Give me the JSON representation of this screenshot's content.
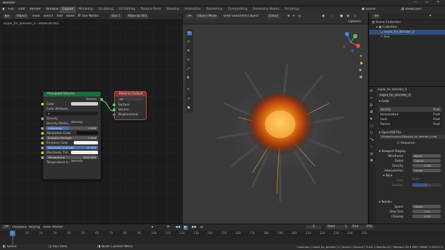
{
  "app": {
    "title": "Blender"
  },
  "menu": [
    "File",
    "Edit",
    "Render",
    "Window",
    "Help"
  ],
  "tabs": [
    "Layout",
    "Modeling",
    "Sculpting",
    "UV Editing",
    "Texture Paint",
    "Shading",
    "Animation",
    "Rendering",
    "Compositing",
    "Geometry Nodes",
    "Scripting"
  ],
  "scene": {
    "label": "Scene",
    "layer": "ViewLayer"
  },
  "node_editor": {
    "header": {
      "type": "Object",
      "view": "View",
      "select": "Select",
      "add": "Add",
      "node": "Node",
      "use_nodes": "Use Nodes",
      "slot": "Slot 1",
      "material": "Material.001"
    },
    "breadcrumb": [
      "explo_for_blender_0",
      "Material.001"
    ],
    "principled": {
      "title": "Principled Volume",
      "output": "Volume",
      "rows": {
        "color": "Color",
        "color_attr": "Color Attribute",
        "color_attr_val": "d",
        "density": "Density",
        "density_attr": "Density Attribu...",
        "density_attr_val": "density",
        "anisotropy": "Anisotropy",
        "anisotropy_val": "0.000",
        "absorption": "Absorption Color",
        "emission_strength": "Emission Strength",
        "emission_strength_val": "0.000",
        "emission_color": "Emission Color",
        "blackbody": "Blackbody Intensity",
        "blackbody_val": "10.000",
        "blackbody_tint": "Blackbody Tint",
        "temperature": "Temperature",
        "temperature_val": "4000.000",
        "temperature_attr": "Temperature A...",
        "temperature_attr_val": "density"
      }
    },
    "output": {
      "title": "Material Output",
      "target": "All",
      "surface": "Surface",
      "volume": "Volume",
      "displacement": "Displacement"
    }
  },
  "viewport": {
    "mode": "Object Mode",
    "view": "View",
    "select": "Select",
    "add": "Add",
    "object": "Object",
    "orientation": "Global",
    "options": "Options"
  },
  "outliner": {
    "search": "",
    "items": [
      {
        "label": "Scene Collection"
      },
      {
        "label": "Collection"
      },
      {
        "label": "explo_for_blender_0"
      },
      {
        "label": "Sun"
      }
    ]
  },
  "properties": {
    "object": "explo_for_blender_0",
    "data": "explo_for_blender_0",
    "grids_title": "Grids",
    "grids": [
      {
        "name": "density",
        "type": "Float"
      },
      {
        "name": "temperature",
        "type": "Float"
      },
      {
        "name": "heat",
        "type": "Float"
      },
      {
        "name": "flames",
        "type": "Float"
      }
    ],
    "openvdb_title": "OpenVDB File",
    "file": "\\\\Fireball\\explo\\VDB\\explo_for_blender_0.vdb",
    "sequence": "Sequence",
    "viewport_display": "Viewport Display",
    "wireframe": {
      "label": "Wireframe",
      "value": "Boxes"
    },
    "detail": {
      "label": "Detail",
      "value": "Coarse"
    },
    "density": {
      "label": "Density",
      "value": "1.000"
    },
    "interp": {
      "label": "Interpolation",
      "value": "Linear"
    },
    "slice": "Slice",
    "axis": {
      "label": "Axis",
      "value": "Auto"
    },
    "position": {
      "label": "Position",
      "value": "0.5"
    },
    "render": "Render",
    "space": {
      "label": "Space",
      "value": "Object"
    },
    "step": {
      "label": "Step Size",
      "value": "0 m"
    },
    "clipping": {
      "label": "Clipping",
      "value": "0.001"
    }
  },
  "timeline": {
    "playback": "Playback",
    "keying": "Keying",
    "view": "View",
    "marker": "Marker",
    "current": "1",
    "start_label": "Start",
    "start": "1",
    "end_label": "End",
    "end": "250",
    "ticks": [
      "0",
      "10",
      "20",
      "30",
      "40",
      "50",
      "60",
      "70",
      "80",
      "90",
      "100",
      "110",
      "120",
      "130",
      "140",
      "150",
      "160",
      "170",
      "180",
      "190",
      "200",
      "210",
      "220",
      "230",
      "240",
      "250"
    ]
  },
  "status": {
    "left": "Select",
    "mid1": "Pan View",
    "mid2": "Node Context Menu",
    "right": "Collection | explo_for_blender_0 | Verts:0 | Faces:0 | Tris:0 | Objects:1/2 | Memory: 85.4 MiB | VRAM: 1.5/24.0 GiB | 3.1.0"
  },
  "colors": {
    "accent": "#4772b3",
    "volume_node": "#1e6b3a",
    "output_node": "#8f2f33",
    "orange": "#e87d0d"
  }
}
